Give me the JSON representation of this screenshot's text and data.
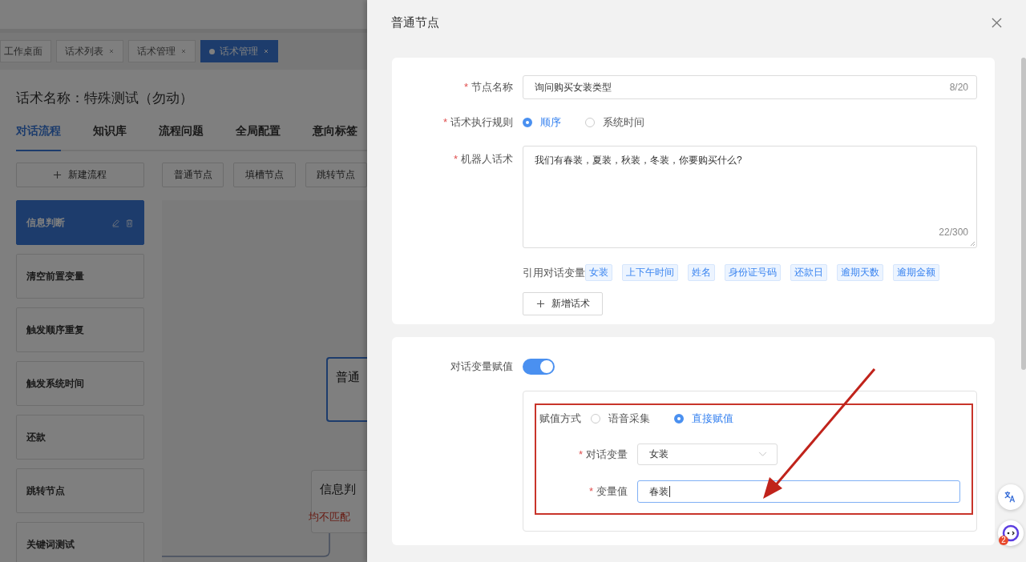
{
  "background": {
    "top_tabs": [
      {
        "label": "工作桌面",
        "closable": false,
        "selected": false
      },
      {
        "label": "话术列表",
        "closable": true,
        "selected": false
      },
      {
        "label": "话术管理",
        "closable": true,
        "selected": false
      },
      {
        "label": "话术管理",
        "closable": true,
        "selected": true
      }
    ],
    "script_title": "话术名称：特殊测试（勿动）",
    "nav_tabs": [
      {
        "label": "对话流程",
        "selected": true
      },
      {
        "label": "知识库",
        "selected": false
      },
      {
        "label": "流程问题",
        "selected": false
      },
      {
        "label": "全局配置",
        "selected": false
      },
      {
        "label": "意向标签",
        "selected": false
      }
    ],
    "new_flow_button": "新建流程",
    "node_buttons": [
      "普通节点",
      "填槽节点",
      "跳转节点"
    ],
    "flows": [
      {
        "label": "信息判断",
        "selected": true
      },
      {
        "label": "清空前置变量",
        "selected": false
      },
      {
        "label": "触发顺序重复",
        "selected": false
      },
      {
        "label": "触发系统时间",
        "selected": false
      },
      {
        "label": "还款",
        "selected": false
      },
      {
        "label": "跳转节点",
        "selected": false
      },
      {
        "label": "关键词测试",
        "selected": false
      }
    ],
    "canvas_nodes": [
      {
        "title": "普通",
        "selected": true
      },
      {
        "title": "信息判",
        "selected": false,
        "branch": "均不匹配"
      }
    ]
  },
  "drawer": {
    "title": "普通节点",
    "node_name": {
      "label": "节点名称",
      "required_mark": "*",
      "value": "询问购买女装类型",
      "counter": "8/20"
    },
    "exec_rule": {
      "label": "话术执行规则",
      "required_mark": "*",
      "options": [
        {
          "label": "顺序",
          "selected": true
        },
        {
          "label": "系统时间",
          "selected": false
        }
      ]
    },
    "robot_speech": {
      "label": "机器人话术",
      "required_mark": "*",
      "value": "我们有春装，夏装，秋装，冬装，你要购买什么?",
      "counter": "22/300"
    },
    "variables": {
      "label": "引用对话变量",
      "tags": [
        "女装",
        "上下午时间",
        "姓名",
        "身份证号码",
        "还款日",
        "逾期天数",
        "逾期金额"
      ]
    },
    "add_button": "新增话术",
    "assign": {
      "label": "对话变量赋值",
      "on": true,
      "method": {
        "label": "赋值方式",
        "options": [
          {
            "label": "语音采集",
            "selected": false
          },
          {
            "label": "直接赋值",
            "selected": true
          }
        ]
      },
      "variable": {
        "label": "对话变量",
        "required_mark": "*",
        "value": "女装"
      },
      "value": {
        "label": "变量值",
        "required_mark": "*",
        "value": "春装"
      }
    }
  },
  "floating": {
    "badge": "2"
  }
}
